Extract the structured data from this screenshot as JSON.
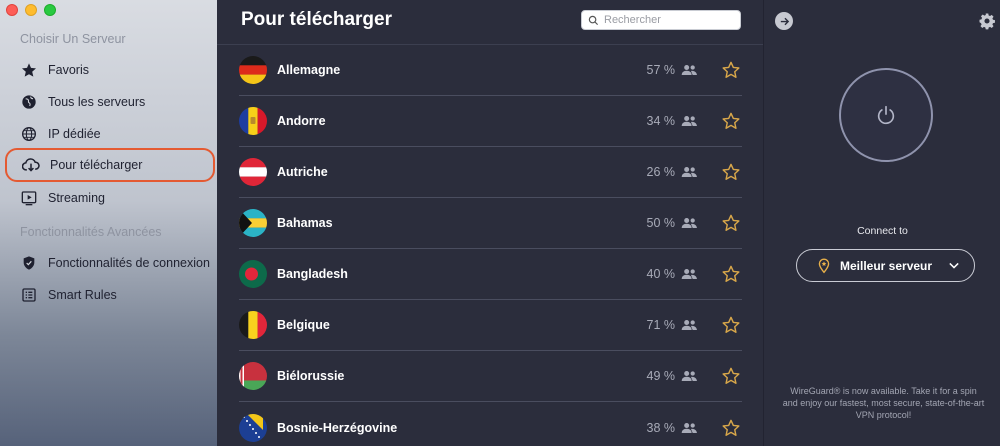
{
  "sidebar": {
    "section_servers": "Choisir Un Serveur",
    "section_advanced": "Fonctionnalités Avancées",
    "items": [
      {
        "label": "Favoris",
        "icon": "star-icon"
      },
      {
        "label": "Tous les serveurs",
        "icon": "globe-icon"
      },
      {
        "label": "IP dédiée",
        "icon": "ip-globe-icon"
      },
      {
        "label": "Pour télécharger",
        "icon": "cloud-download-icon",
        "active": true
      },
      {
        "label": "Streaming",
        "icon": "play-screen-icon"
      },
      {
        "label": "Fonctionnalités de connexion",
        "icon": "shield-icon"
      },
      {
        "label": "Smart Rules",
        "icon": "list-icon"
      }
    ]
  },
  "main": {
    "title": "Pour télécharger",
    "search_placeholder": "Rechercher",
    "countries": [
      {
        "name": "Allemagne",
        "load": "57 %"
      },
      {
        "name": "Andorre",
        "load": "34 %"
      },
      {
        "name": "Autriche",
        "load": "26 %"
      },
      {
        "name": "Bahamas",
        "load": "50 %"
      },
      {
        "name": "Bangladesh",
        "load": "40 %"
      },
      {
        "name": "Belgique",
        "load": "71 %"
      },
      {
        "name": "Biélorussie",
        "load": "49 %"
      },
      {
        "name": "Bosnie-Herzégovine",
        "load": "38 %"
      }
    ]
  },
  "right_panel": {
    "connect_to": "Connect to",
    "best_server": "Meilleur serveur",
    "footnote": "WireGuard® is now available. Take it for a spin and enjoy our fastest, most secure, state-of-the-art VPN protocol!"
  },
  "colors": {
    "accent_ring": "#e45a32",
    "star": "#d8a74a",
    "background": "#2b2d3c"
  }
}
